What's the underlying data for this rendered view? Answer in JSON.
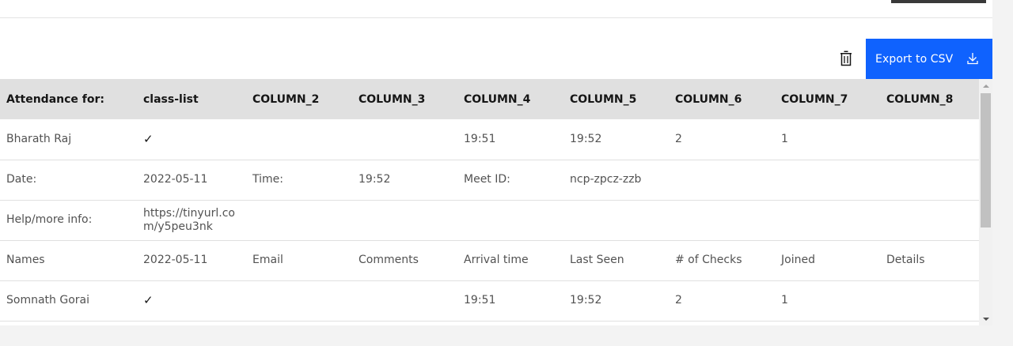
{
  "toolbar": {
    "export_label": "Export to CSV",
    "delete_icon": "trash-can-icon",
    "export_icon": "download-icon",
    "accent_color": "#0f62fe"
  },
  "table": {
    "headers": [
      "Attendance for:",
      "class-list",
      "COLUMN_2",
      "COLUMN_3",
      "COLUMN_4",
      "COLUMN_5",
      "COLUMN_6",
      "COLUMN_7",
      "COLUMN_8"
    ],
    "rows": [
      [
        "Bharath Raj",
        "✓",
        "",
        "",
        "19:51",
        "19:52",
        "2",
        "1",
        ""
      ],
      [
        "Date:",
        "2022-05-11",
        "Time:",
        "19:52",
        "Meet ID:",
        "ncp-zpcz-zzb",
        "",
        "",
        ""
      ],
      [
        "Help/more info:",
        "https://tinyurl.com/y5peu3nk",
        "",
        "",
        "",
        "",
        "",
        "",
        ""
      ],
      [
        "Names",
        "2022-05-11",
        "Email",
        "Comments",
        "Arrival time",
        "Last Seen",
        "# of Checks",
        "Joined",
        "Details"
      ],
      [
        "Somnath Gorai",
        "✓",
        "",
        "",
        "19:51",
        "19:52",
        "2",
        "1",
        ""
      ]
    ]
  }
}
